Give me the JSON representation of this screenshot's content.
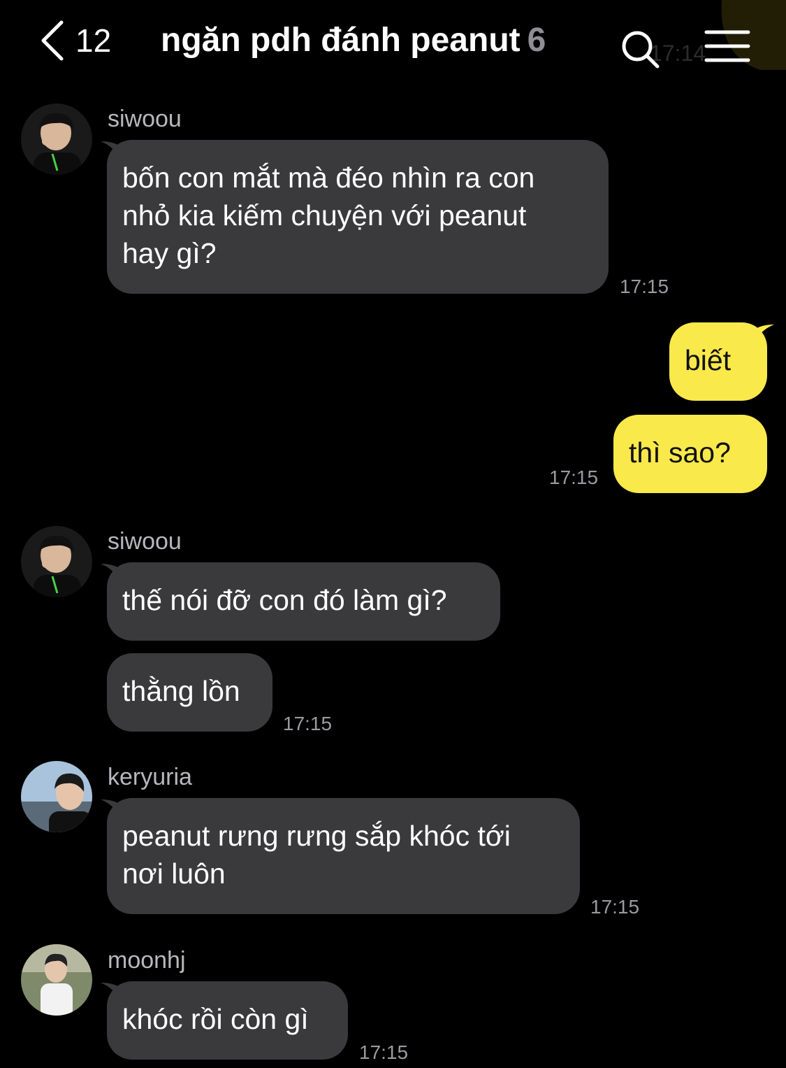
{
  "header": {
    "back_count": "12",
    "title": "ngăn pdh đánh peanut",
    "member_count": "6",
    "ghost_time": "17:14"
  },
  "colors": {
    "background": "#000000",
    "incoming_bubble": "#3a3a3c",
    "outgoing_bubble": "#fae94b"
  },
  "messages": [
    {
      "sender": "siwoou",
      "text": "bốn con mắt mà đéo nhìn ra con\nnhỏ kia kiếm chuyện với peanut\nhay gì?",
      "time": "17:15"
    },
    {
      "text": "biết"
    },
    {
      "text": "thì sao?",
      "time": "17:15"
    },
    {
      "sender": "siwoou",
      "text": "thế nói đỡ con đó làm gì?"
    },
    {
      "text": "thằng lồn",
      "time": "17:15"
    },
    {
      "sender": "keryuria",
      "text": "peanut rưng rưng sắp khóc tới\nnơi luôn",
      "time": "17:15"
    },
    {
      "sender": "moonhj",
      "text": "khóc rồi còn gì",
      "time": "17:15"
    }
  ]
}
